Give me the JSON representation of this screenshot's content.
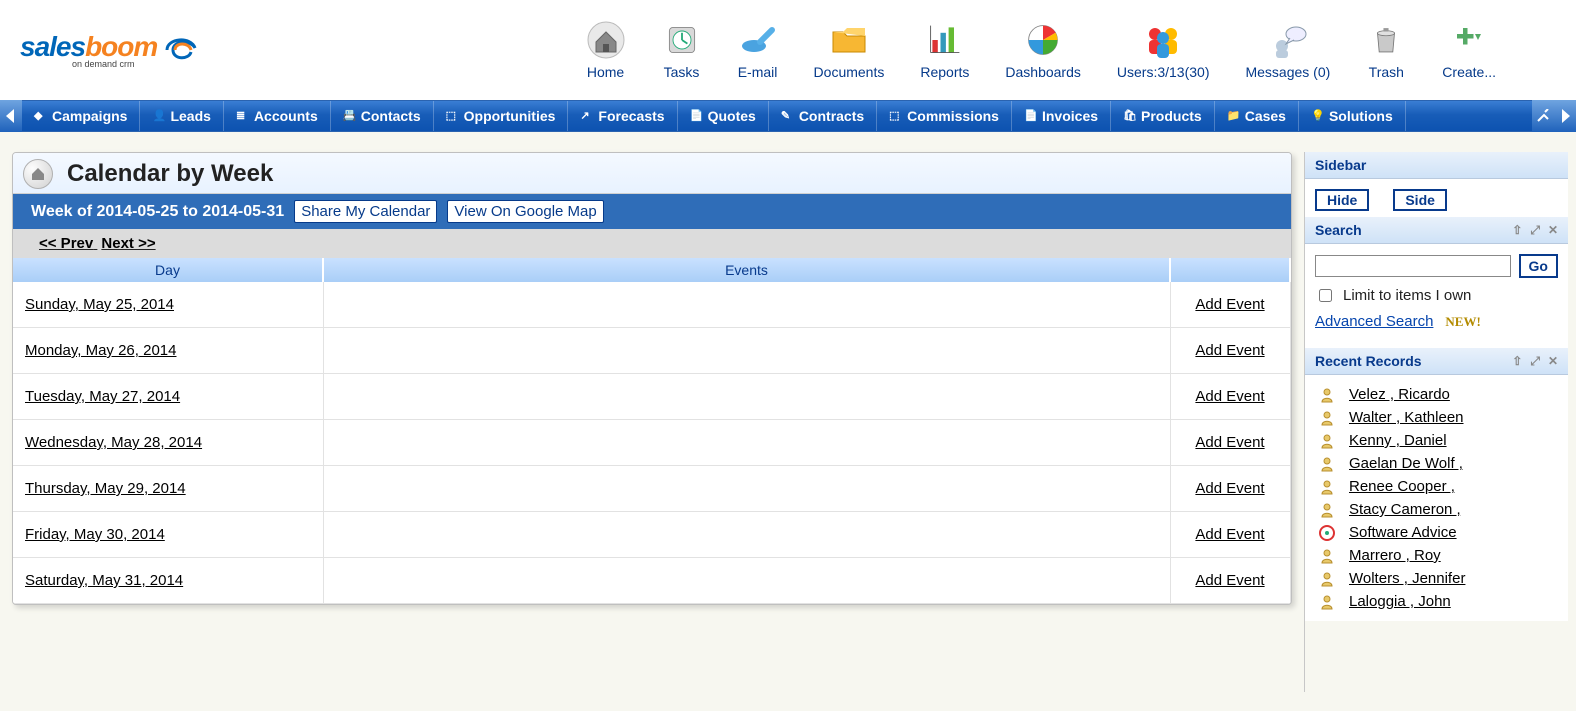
{
  "topbar": {
    "items": [
      {
        "label": "Home"
      },
      {
        "label": "Tasks"
      },
      {
        "label": "E-mail"
      },
      {
        "label": "Documents"
      },
      {
        "label": "Reports"
      },
      {
        "label": "Dashboards"
      },
      {
        "label": "Users:3/13(30)"
      },
      {
        "label": "Messages (0)"
      },
      {
        "label": "Trash"
      },
      {
        "label": "Create..."
      }
    ]
  },
  "nav": {
    "items": [
      "Campaigns",
      "Leads",
      "Accounts",
      "Contacts",
      "Opportunities",
      "Forecasts",
      "Quotes",
      "Contracts",
      "Commissions",
      "Invoices",
      "Products",
      "Cases",
      "Solutions"
    ]
  },
  "panel": {
    "title": "Calendar by Week",
    "week_label": "Week of 2014-05-25 to 2014-05-31",
    "share_btn": "Share My Calendar",
    "map_btn": "View On Google Map",
    "prev": "<< Prev",
    "next": "Next >>",
    "cols": {
      "day": "Day",
      "events": "Events",
      "add": ""
    },
    "rows": [
      {
        "day": "Sunday, May 25, 2014",
        "add": "Add Event"
      },
      {
        "day": "Monday, May 26, 2014",
        "add": "Add Event"
      },
      {
        "day": "Tuesday, May 27, 2014",
        "add": "Add Event"
      },
      {
        "day": "Wednesday, May 28, 2014",
        "add": "Add Event"
      },
      {
        "day": "Thursday, May 29, 2014",
        "add": "Add Event"
      },
      {
        "day": "Friday, May 30, 2014",
        "add": "Add Event"
      },
      {
        "day": "Saturday, May 31, 2014",
        "add": "Add Event"
      }
    ]
  },
  "sidebar": {
    "title": "Sidebar",
    "hide": "Hide",
    "side": "Side",
    "search": {
      "title": "Search",
      "go": "Go",
      "limit": "Limit to items I own",
      "advanced": "Advanced Search",
      "new": "NEW!"
    },
    "recent": {
      "title": "Recent Records",
      "items": [
        {
          "name": "Velez , Ricardo",
          "type": "person"
        },
        {
          "name": "Walter , Kathleen",
          "type": "person"
        },
        {
          "name": "Kenny , Daniel",
          "type": "person"
        },
        {
          "name": "Gaelan De Wolf ,",
          "type": "person"
        },
        {
          "name": "Renee Cooper ,",
          "type": "person"
        },
        {
          "name": "Stacy Cameron ,",
          "type": "person"
        },
        {
          "name": "Software Advice",
          "type": "object"
        },
        {
          "name": "Marrero , Roy",
          "type": "person"
        },
        {
          "name": "Wolters , Jennifer",
          "type": "person"
        },
        {
          "name": "Laloggia , John",
          "type": "person"
        }
      ]
    }
  }
}
